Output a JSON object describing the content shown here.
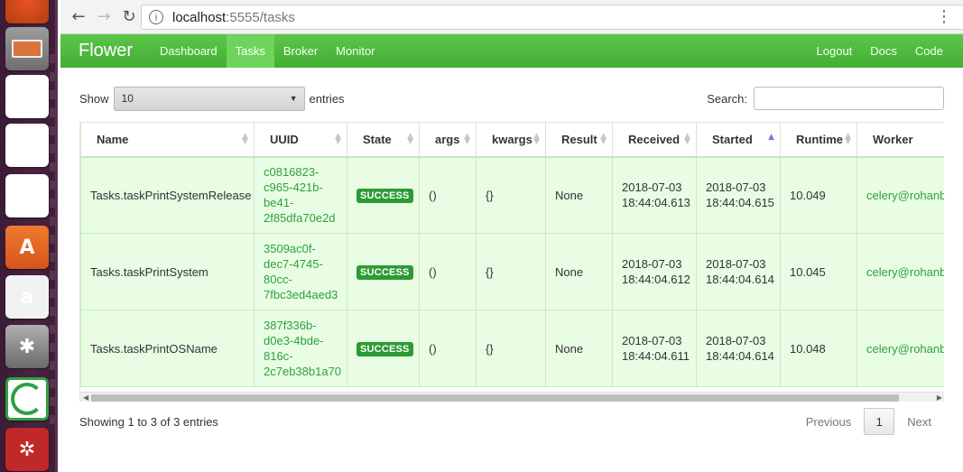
{
  "launcher": {
    "apps": [
      "ubuntu-dash-icon",
      "files-icon",
      "writer-icon",
      "calc-icon",
      "impress-icon",
      "software-center-icon",
      "amazon-icon",
      "system-settings-icon",
      "circle-app-icon",
      "web-app-icon"
    ],
    "amazon_glyph": "a",
    "store_glyph": "A"
  },
  "browser": {
    "url_host": "localhost",
    "url_path": ":5555/tasks",
    "info_glyph": "i"
  },
  "navbar": {
    "brand": "Flower",
    "left_items": [
      "Dashboard",
      "Tasks",
      "Broker",
      "Monitor"
    ],
    "active": "Tasks",
    "right_items": [
      "Logout",
      "Docs",
      "Code"
    ]
  },
  "controls": {
    "show_label": "Show",
    "page_size": "10",
    "entries_label": "entries",
    "search_label": "Search:"
  },
  "table": {
    "columns": [
      "Name",
      "UUID",
      "State",
      "args",
      "kwargs",
      "Result",
      "Received",
      "Started",
      "Runtime",
      "Worker"
    ],
    "sorted_column": "Started",
    "rows": [
      {
        "name": "Tasks.taskPrintSystemRelease",
        "uuid": [
          "c0816823-",
          "c965-421b-",
          "be41-",
          "2f85dfa70e2d"
        ],
        "state": "SUCCESS",
        "args": "()",
        "kwargs": "{}",
        "result": "None",
        "received": [
          "2018-07-03",
          "18:44:04.613"
        ],
        "started": [
          "2018-07-03",
          "18:44:04.615"
        ],
        "runtime": "10.049",
        "worker": "celery@rohanba"
      },
      {
        "name": "Tasks.taskPrintSystem",
        "uuid": [
          "3509ac0f-",
          "dec7-4745-",
          "80cc-",
          "7fbc3ed4aed3"
        ],
        "state": "SUCCESS",
        "args": "()",
        "kwargs": "{}",
        "result": "None",
        "received": [
          "2018-07-03",
          "18:44:04.612"
        ],
        "started": [
          "2018-07-03",
          "18:44:04.614"
        ],
        "runtime": "10.045",
        "worker": "celery@rohanba"
      },
      {
        "name": "Tasks.taskPrintOSName",
        "uuid": [
          "387f336b-",
          "d0e3-4bde-",
          "816c-",
          "2c7eb38b1a70"
        ],
        "state": "SUCCESS",
        "args": "()",
        "kwargs": "{}",
        "result": "None",
        "received": [
          "2018-07-03",
          "18:44:04.611"
        ],
        "started": [
          "2018-07-03",
          "18:44:04.614"
        ],
        "runtime": "10.048",
        "worker": "celery@rohanba"
      }
    ]
  },
  "footer": {
    "info": "Showing 1 to 3 of 3 entries",
    "previous": "Previous",
    "page": "1",
    "next": "Next"
  },
  "colors": {
    "navbar": "#4cb83a",
    "row_bg": "#e8fde3",
    "link_green": "#2ea043",
    "badge_green": "#2d9b34"
  }
}
